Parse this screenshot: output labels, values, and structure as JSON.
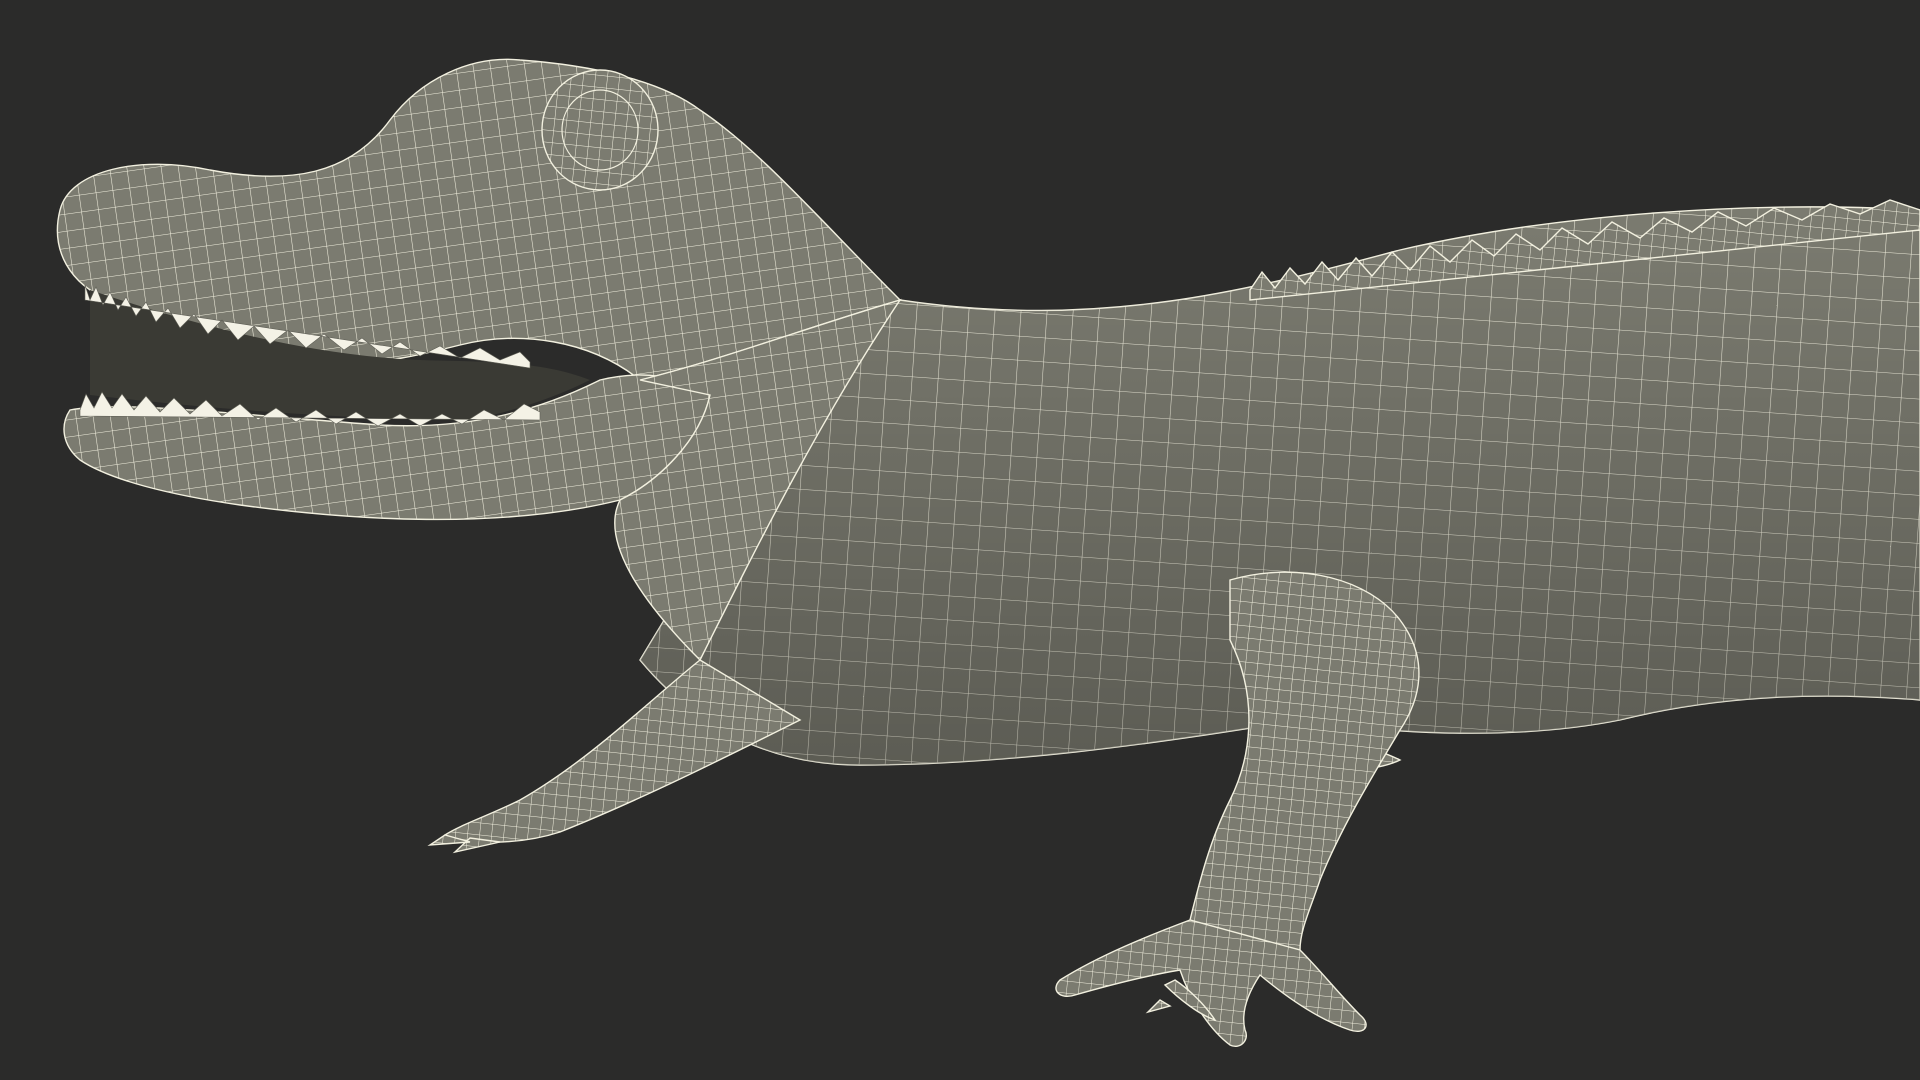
{
  "scene": {
    "subject": "alligator-wireframe-model",
    "background_color": "#2b2b2a",
    "surface_color": "#7b7b70",
    "surface_shadow_color": "#5f5f56",
    "wire_color": "#f2f0df",
    "mouth_color": "#3a3a34",
    "teeth_color": "#f4f2e6"
  }
}
